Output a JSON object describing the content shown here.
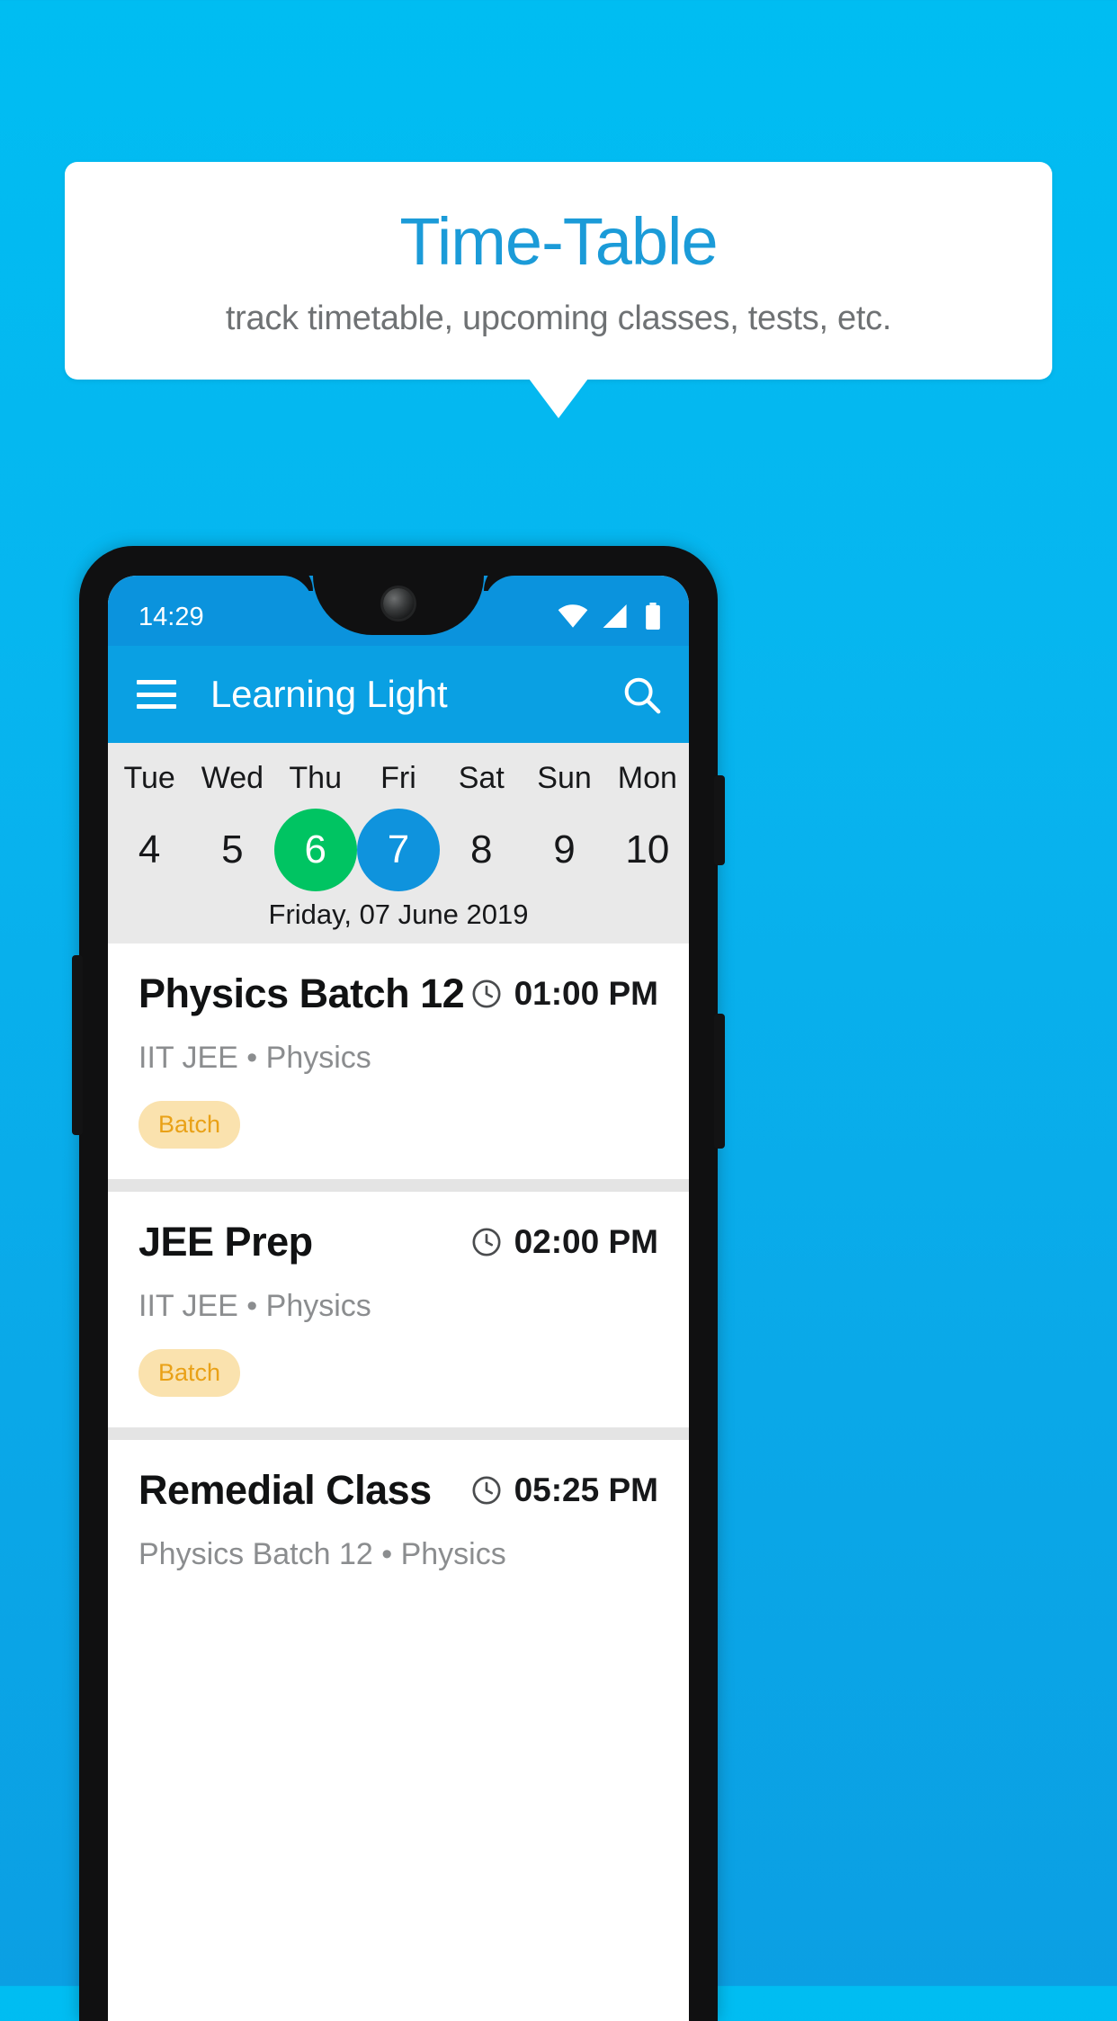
{
  "promo": {
    "title": "Time-Table",
    "subtitle": "track timetable, upcoming classes, tests, etc.",
    "title_color": "#1b9bd8",
    "background_color": "#00bdf2"
  },
  "phone": {
    "status_bar": {
      "time": "14:29",
      "icons": [
        "wifi-icon",
        "signal-icon",
        "battery-icon"
      ]
    },
    "app_bar": {
      "menu_icon": "hamburger-menu-icon",
      "title": "Learning Light",
      "search_icon": "search-icon"
    },
    "date_strip": {
      "days": [
        {
          "dow": "Tue",
          "num": "4",
          "state": "normal"
        },
        {
          "dow": "Wed",
          "num": "5",
          "state": "normal"
        },
        {
          "dow": "Thu",
          "num": "6",
          "state": "today"
        },
        {
          "dow": "Fri",
          "num": "7",
          "state": "selected"
        },
        {
          "dow": "Sat",
          "num": "8",
          "state": "normal"
        },
        {
          "dow": "Sun",
          "num": "9",
          "state": "normal"
        },
        {
          "dow": "Mon",
          "num": "10",
          "state": "normal"
        }
      ],
      "selected_date_label": "Friday, 07 June 2019",
      "today_color": "#00c462",
      "selected_color": "#0f93dd"
    },
    "classes": [
      {
        "title": "Physics Batch 12",
        "time": "01:00 PM",
        "subtitle": "IIT JEE • Physics",
        "badge": "Batch"
      },
      {
        "title": "JEE Prep",
        "time": "02:00 PM",
        "subtitle": "IIT JEE • Physics",
        "badge": "Batch"
      },
      {
        "title": "Remedial Class",
        "time": "05:25 PM",
        "subtitle": "Physics Batch 12 • Physics",
        "badge": ""
      }
    ]
  }
}
